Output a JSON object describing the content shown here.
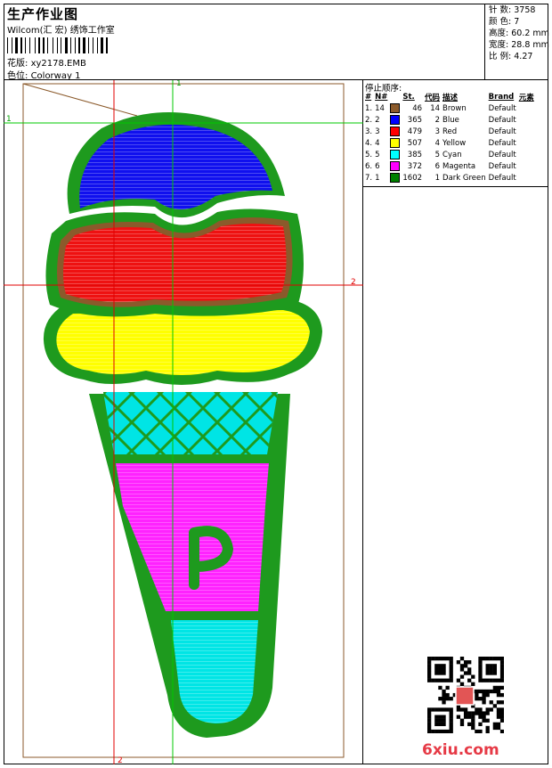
{
  "header": {
    "title": "生产作业图",
    "subtitle": "Wilcom(汇 宏) 绣饰工作室",
    "pattern_label": "花版:",
    "pattern_value": "xy2178.EMB",
    "colorway_label": "色位:",
    "colorway_value": "Colorway 1"
  },
  "stats": [
    {
      "label": "针 数:",
      "value": "3758"
    },
    {
      "label": "颜 色:",
      "value": "7"
    },
    {
      "label": "高度:",
      "value": "60.2 mm"
    },
    {
      "label": "宽度:",
      "value": "28.8 mm"
    },
    {
      "label": "比 例:",
      "value": "4.27"
    }
  ],
  "stop_sequence": {
    "title": "停止顺序:",
    "headers": [
      "#",
      "N#",
      "St.",
      "代码",
      "描述",
      "Brand",
      "元素"
    ],
    "rows": [
      {
        "idx": "1.",
        "n": "14",
        "color": "#8b5a2b",
        "st": "46",
        "code": "14",
        "desc": "Brown",
        "brand": "Default"
      },
      {
        "idx": "2.",
        "n": "2",
        "color": "#0000ff",
        "st": "365",
        "code": "2",
        "desc": "Blue",
        "brand": "Default"
      },
      {
        "idx": "3.",
        "n": "3",
        "color": "#ff0000",
        "st": "479",
        "code": "3",
        "desc": "Red",
        "brand": "Default"
      },
      {
        "idx": "4.",
        "n": "4",
        "color": "#ffff00",
        "st": "507",
        "code": "4",
        "desc": "Yellow",
        "brand": "Default"
      },
      {
        "idx": "5.",
        "n": "5",
        "color": "#00ffff",
        "st": "385",
        "code": "5",
        "desc": "Cyan",
        "brand": "Default"
      },
      {
        "idx": "6.",
        "n": "6",
        "color": "#ff00ff",
        "st": "372",
        "code": "6",
        "desc": "Magenta",
        "brand": "Default"
      },
      {
        "idx": "7.",
        "n": "1",
        "color": "#008000",
        "st": "1602",
        "code": "1",
        "desc": "Dark Green",
        "brand": "Default"
      }
    ]
  },
  "guides": {
    "v1": "1",
    "v2": "2",
    "h1": "1",
    "h2": "2"
  },
  "watermark": "6xiu.com",
  "palette": {
    "green": "#1e9a1e",
    "brown": "#8b5a2b",
    "guide_red": "#e00000",
    "guide_green": "#00c800"
  }
}
